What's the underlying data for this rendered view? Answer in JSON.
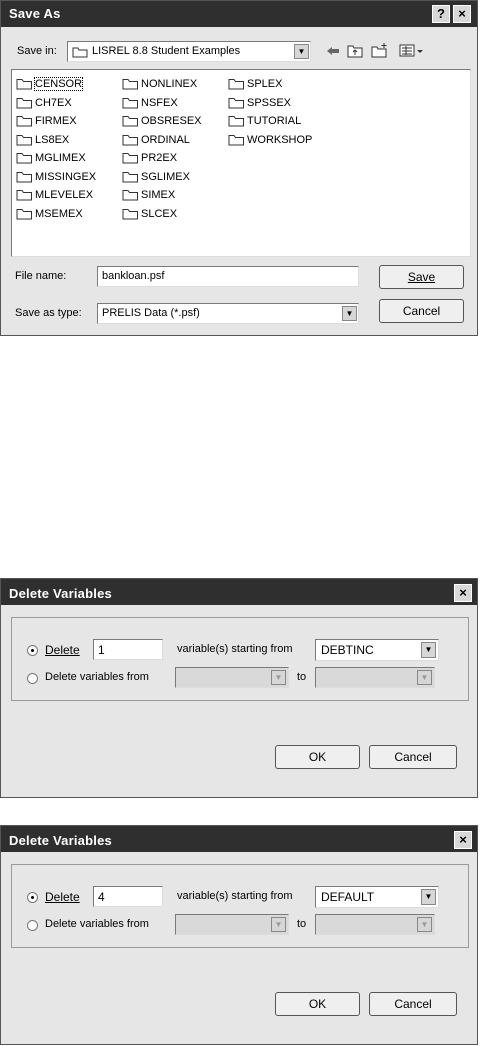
{
  "save_as": {
    "title": "Save As",
    "help_label": "?",
    "close_label": "×",
    "save_in_label": "Save in:",
    "save_in_value": "LISREL 8.8 Student Examples",
    "folders": [
      "CENSOR",
      "CH7EX",
      "FIRMEX",
      "LS8EX",
      "MGLIMEX",
      "MISSINGEX",
      "MLEVELEX",
      "MSEMEX",
      "NONLINEX",
      "NSFEX",
      "OBSRESEX",
      "ORDINAL",
      "PR2EX",
      "SGLIMEX",
      "SIMEX",
      "SLCEX",
      "SPLEX",
      "SPSSEX",
      "TUTORIAL",
      "WORKSHOP"
    ],
    "file_name_label": "File name:",
    "file_name_value": "bankloan.psf",
    "save_as_type_label": "Save as type:",
    "save_as_type_value": "PRELIS Data (*.psf)",
    "save_button": "Save",
    "cancel_button": "Cancel"
  },
  "delete_dialogs": [
    {
      "title": "Delete Variables",
      "close_label": "×",
      "delete_label": "Delete",
      "count_value": "1",
      "starting_label": "variable(s) starting from",
      "starting_value": "DEBTINC",
      "range_label": "Delete variables from",
      "to_label": "to",
      "ok_button": "OK",
      "cancel_button": "Cancel"
    },
    {
      "title": "Delete Variables",
      "close_label": "×",
      "delete_label": "Delete",
      "count_value": "4",
      "starting_label": "variable(s) starting from",
      "starting_value": "DEFAULT",
      "range_label": "Delete variables from",
      "to_label": "to",
      "ok_button": "OK",
      "cancel_button": "Cancel"
    }
  ]
}
